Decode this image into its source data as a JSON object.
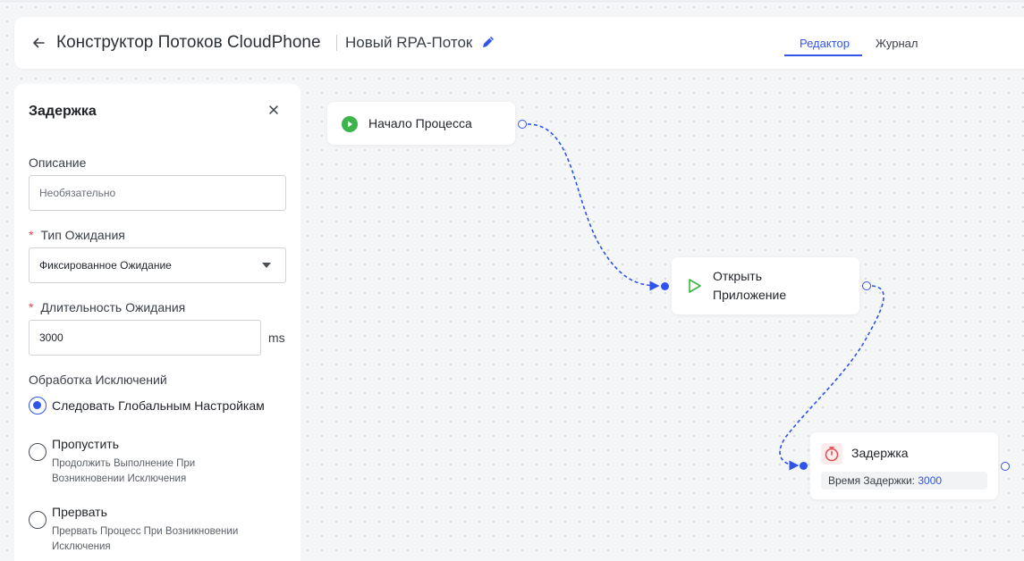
{
  "header": {
    "app_title": "Конструктор Потоков CloudPhone",
    "flow_name": "Новый RPA-Поток",
    "tabs": [
      {
        "label": "Редактор",
        "active": true
      },
      {
        "label": "Журнал",
        "active": false
      }
    ]
  },
  "panel": {
    "title": "Задержка",
    "description": {
      "label": "Описание",
      "placeholder": "Необязательно",
      "value": ""
    },
    "wait_type": {
      "label": "Тип Ожидания",
      "required": true,
      "value": "Фиксированное Ожидание"
    },
    "wait_duration": {
      "label": "Длительность Ожидания",
      "required": true,
      "value": "3000",
      "unit": "ms"
    },
    "exception_handling": {
      "label": "Обработка Исключений",
      "options": [
        {
          "label": "Следовать Глобальным Настройкам",
          "description": "",
          "selected": true
        },
        {
          "label": "Пропустить",
          "description": "Продолжить Выполнение При Возникновении Исключения",
          "selected": false
        },
        {
          "label": "Прервать",
          "description": "Прервать Процесс При Возникновении Исключения",
          "selected": false
        }
      ]
    }
  },
  "canvas": {
    "nodes": [
      {
        "label": "Начало Процесса",
        "icon": "play-circle-icon"
      },
      {
        "label": "Открыть Приложение",
        "icon": "play-outline-icon"
      },
      {
        "label": "Задержка",
        "icon": "stopwatch-icon",
        "detail_label": "Время Задержки:",
        "detail_value": "3000"
      }
    ]
  },
  "colors": {
    "accent": "#2f54eb",
    "required": "#e5484d",
    "start_node": "#3bb54a",
    "delay_node": "#e5484d"
  }
}
